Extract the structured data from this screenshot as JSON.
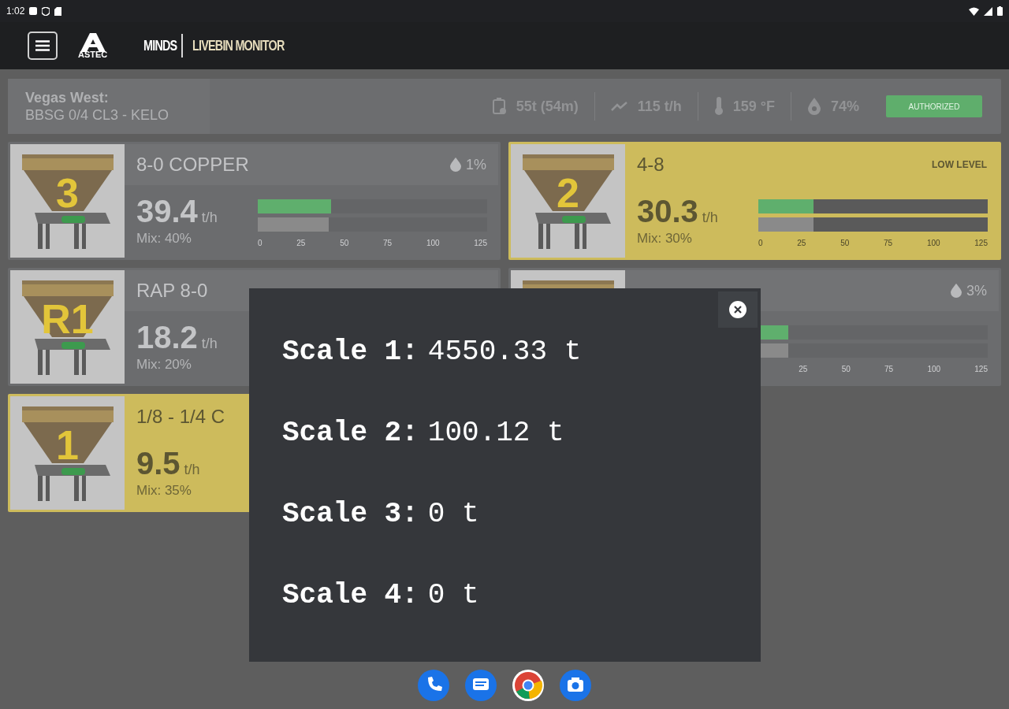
{
  "status_bar": {
    "time": "1:02"
  },
  "header": {
    "app": "MINDS",
    "section": "LIVEBIN MONITOR",
    "logo_text": "ASTEC"
  },
  "site": {
    "name": "Vegas West:",
    "mix": "BBSG 0/4 CL3 - KELO"
  },
  "stats": [
    {
      "kind": "tons",
      "text": "55t (54m)"
    },
    {
      "kind": "rate",
      "text": "115 t/h"
    },
    {
      "kind": "temperature",
      "text": "159 °F"
    },
    {
      "kind": "moisture",
      "text": "74%"
    }
  ],
  "status_badge": {
    "label": "AUTHORIZED"
  },
  "bins": [
    {
      "bin": "3",
      "name": "8-0 COPPER",
      "moisture": "1%",
      "rate": "39.4",
      "unit": "t/h",
      "mix": "Mix: 40%",
      "alert": false,
      "feed": {
        "level": 0.32
      },
      "target": {
        "level": 0.31
      },
      "ticks": [
        "0",
        "25",
        "50",
        "75",
        "100",
        "125"
      ]
    },
    {
      "bin": "2",
      "name": "4-8",
      "alert_label": "LOW LEVEL",
      "rate": "30.3",
      "unit": "t/h",
      "mix": "Mix: 30%",
      "alert": true,
      "feed": {
        "level": 0.24
      },
      "target": {
        "level": 0.24
      },
      "ticks": [
        "0",
        "25",
        "50",
        "75",
        "100",
        "125"
      ]
    },
    {
      "bin": "R1",
      "name": "RAP 8-0",
      "rate": "18.2",
      "unit": "t/h",
      "mix": "Mix: 20%",
      "alert": false
    },
    {
      "moisture": "3%",
      "alert": false,
      "feed": {
        "level": 0.13
      },
      "target": {
        "level": 0.13
      },
      "ticks": [
        "25",
        "50",
        "75",
        "100",
        "125"
      ]
    },
    {
      "bin": "1",
      "name": "1/8 - 1/4 C",
      "rate": "9.5",
      "unit": "t/h",
      "mix": "Mix: 35%",
      "alert": true
    }
  ],
  "scale_popup": {
    "rows": [
      {
        "label": "Scale 1:",
        "value": "4550.33 t"
      },
      {
        "label": "Scale 2:",
        "value": "100.12 t"
      },
      {
        "label": "Scale 3:",
        "value": "0 t"
      },
      {
        "label": "Scale 4:",
        "value": "0 t"
      }
    ]
  },
  "dock": [
    {
      "kind": "phone"
    },
    {
      "kind": "messages"
    },
    {
      "kind": "browser"
    },
    {
      "kind": "camera"
    }
  ]
}
